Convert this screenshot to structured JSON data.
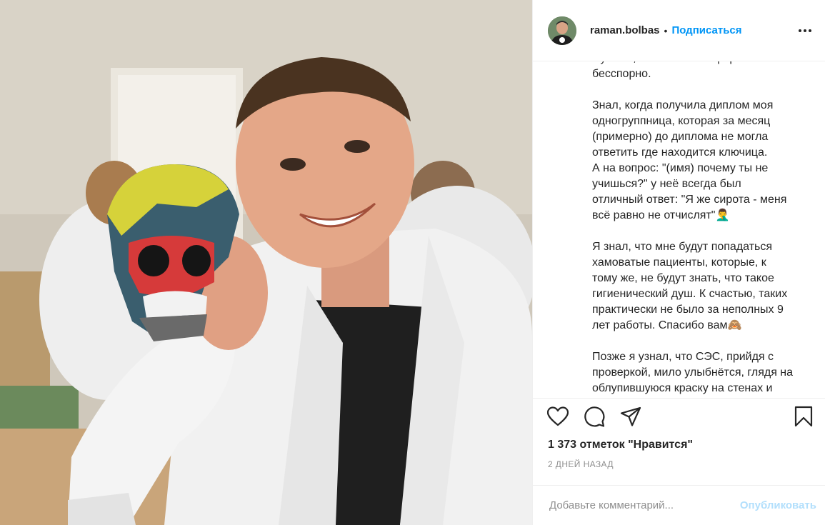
{
  "photo": {
    "description_icon": "post-photo"
  },
  "header": {
    "username": "raman.bolbas",
    "separator": "•",
    "follow_label": "Подписаться",
    "more_icon": "more-horizontal-icon"
  },
  "caption": {
    "text": "Нужнее, чем латынь и фарма - это\nбесспорно.\n\nЗнал, когда получила диплом моя\nодногруппница, которая за месяц\n(примерно) до диплома не могла\nответить где находится ключица.\nА на вопрос: \"(имя) почему ты не\nучишься?\" у неё всегда был\nотличный ответ: \"Я же сирота - меня\nвсё равно не отчислят\"🤦‍♂️\n\nЯ знал, что мне будут попадаться\nхамоватые пациенты, которые, к\nтому же, не будут знать, что такое\nгигиенический душ. К счастью, таких\nпрактически не было за неполных 9\nлет работы. Спасибо вам🙈\n\nПозже я узнал, что СЭС, прийдя с\nпроверкой, мило улыбнётся, глядя на\nоблупившуюся краску на стенах и"
  },
  "actions": {
    "like_icon": "heart-icon",
    "comment_icon": "comment-icon",
    "share_icon": "share-icon",
    "save_icon": "bookmark-icon"
  },
  "likes_text": "1 373 отметок \"Нравится\"",
  "time_text": "2 ДНЕЙ НАЗАД",
  "comment": {
    "placeholder": "Добавьте комментарий...",
    "publish_label": "Опубликовать"
  },
  "colors": {
    "accent": "#0095f6",
    "publish_disabled": "#b2dffc",
    "text": "#262626",
    "muted": "#8e8e8e"
  }
}
